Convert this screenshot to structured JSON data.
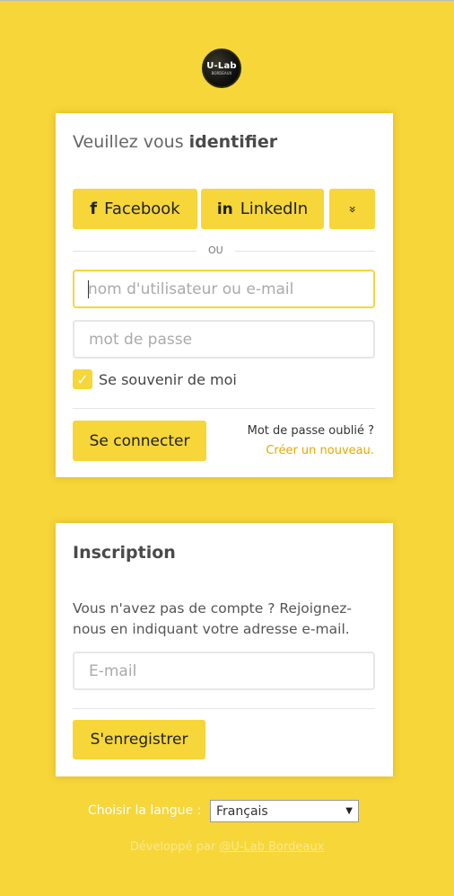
{
  "logo": {
    "title": "U-Lab",
    "subtitle": "BORDEAUX"
  },
  "login": {
    "title_prefix": "Veuillez vous",
    "title_bold": "identifier",
    "facebook_label": "Facebook",
    "linkedin_label": "LinkedIn",
    "facebook_icon": "f",
    "linkedin_icon": "in",
    "more_icon": "»",
    "separator": "OU",
    "username_placeholder": "nom d'utilisateur ou e-mail",
    "password_placeholder": "mot de passe",
    "remember_label": "Se souvenir de moi",
    "remember_checked": true,
    "submit_label": "Se connecter",
    "forgot_text": "Mot de passe oublié ?",
    "create_link": "Créer un nouveau."
  },
  "register": {
    "title": "Inscription",
    "description": "Vous n'avez pas de compte ? Rejoignez-nous en indiquant votre adresse e-mail.",
    "email_placeholder": "E-mail",
    "submit_label": "S'enregistrer"
  },
  "language": {
    "label": "Choisir la langue :",
    "selected": "Français"
  },
  "footer": {
    "prefix": "Développé par ",
    "link": "@U-Lab Bordeaux"
  },
  "colors": {
    "accent": "#f6d639",
    "link": "#e6a800",
    "background": "#f6d639"
  }
}
